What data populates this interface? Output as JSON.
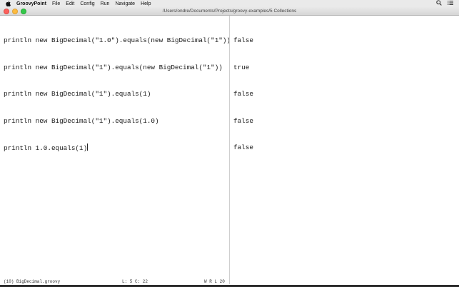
{
  "menubar": {
    "app_name": "GroovyPoint",
    "items": [
      "File",
      "Edit",
      "Config",
      "Run",
      "Navigate",
      "Help"
    ],
    "icons": [
      "apple-icon",
      "search-icon",
      "list-icon"
    ]
  },
  "window": {
    "title": "/Users/ondre/Documents/Projects/groovy-examples/5 Collections"
  },
  "editor": {
    "lines": [
      "println new BigDecimal(\"1.0\").equals(new BigDecimal(\"1\"))",
      "println new BigDecimal(\"1\").equals(new BigDecimal(\"1\"))",
      "println new BigDecimal(\"1\").equals(1)",
      "println new BigDecimal(\"1\").equals(1.0)",
      "println 1.0.equals(1)"
    ]
  },
  "output": {
    "lines": [
      "false",
      "true",
      "false",
      "false",
      "false"
    ]
  },
  "status": {
    "file": "(10) BigDecimal.groovy",
    "position": "L: 5 C: 22",
    "flags": "W R L 20"
  },
  "colors": {
    "close": "#fc605c",
    "minimize": "#fdbc40",
    "maximize": "#34c84a"
  }
}
